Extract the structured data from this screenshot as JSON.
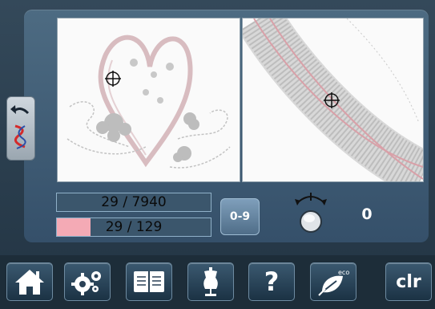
{
  "counters": {
    "stitch_count": "29 / 7940",
    "color_count": "29 / 129",
    "color_progress": 0.22
  },
  "number_button": {
    "label": "0-9"
  },
  "knob": {
    "value": "0"
  },
  "toolbar": {
    "clear_label": "clr",
    "help_label": "?",
    "eco_label": "eco"
  },
  "icons": {
    "home": "home-icon",
    "settings": "gears-icon",
    "tutorial": "book-icon",
    "design": "dress-form-icon",
    "help": "question-icon",
    "eco": "leaf-icon",
    "side": "return-stitch-icon"
  },
  "colors": {
    "progress": "#f4aab5",
    "panel": "#4d6b82",
    "toolbar": "#1d2d39"
  }
}
